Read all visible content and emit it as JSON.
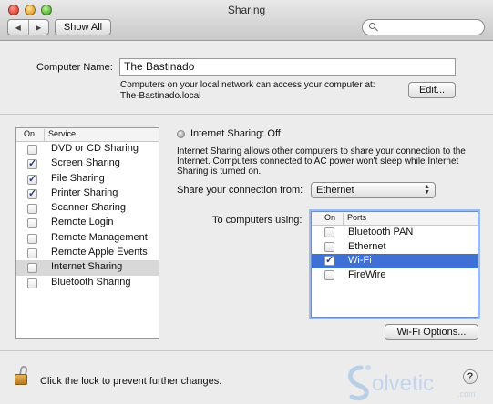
{
  "window": {
    "title": "Sharing"
  },
  "toolbar": {
    "back_glyph": "◀",
    "forward_glyph": "▶",
    "show_all_label": "Show All",
    "search_placeholder": ""
  },
  "computer": {
    "name_label": "Computer Name:",
    "name_value": "The Bastinado",
    "info_line1": "Computers on your local network can access your computer at:",
    "info_line2": "The-Bastinado.local",
    "edit_label": "Edit..."
  },
  "services": {
    "header_on": "On",
    "header_service": "Service",
    "items": [
      {
        "label": "DVD or CD Sharing",
        "checked": false
      },
      {
        "label": "Screen Sharing",
        "checked": true
      },
      {
        "label": "File Sharing",
        "checked": true
      },
      {
        "label": "Printer Sharing",
        "checked": true
      },
      {
        "label": "Scanner Sharing",
        "checked": false
      },
      {
        "label": "Remote Login",
        "checked": false
      },
      {
        "label": "Remote Management",
        "checked": false
      },
      {
        "label": "Remote Apple Events",
        "checked": false
      },
      {
        "label": "Internet Sharing",
        "checked": false,
        "selected": true
      },
      {
        "label": "Bluetooth Sharing",
        "checked": false
      }
    ]
  },
  "detail": {
    "status_title": "Internet Sharing: Off",
    "desc_line1": "Internet Sharing allows other computers to share your connection to the",
    "desc_line2": "Internet. Computers connected to AC power won't sleep while Internet",
    "desc_line3": "Sharing is turned on.",
    "share_from_label": "Share your connection from:",
    "share_from_value": "Ethernet",
    "to_computers_label": "To computers using:",
    "ports_header_on": "On",
    "ports_header_ports": "Ports",
    "ports": [
      {
        "label": "Bluetooth PAN",
        "checked": false
      },
      {
        "label": "Ethernet",
        "checked": false
      },
      {
        "label": "Wi-Fi",
        "checked": true,
        "selected": true
      },
      {
        "label": "FireWire",
        "checked": false
      }
    ],
    "wifi_options_label": "Wi-Fi Options..."
  },
  "footer": {
    "lock_text": "Click the lock to prevent further changes.",
    "help_glyph": "?"
  },
  "watermark": {
    "text": "olvetic",
    "suffix": ".com"
  },
  "colors": {
    "selection_blue": "#3e70d6",
    "check_blue": "#1b3f8f"
  }
}
